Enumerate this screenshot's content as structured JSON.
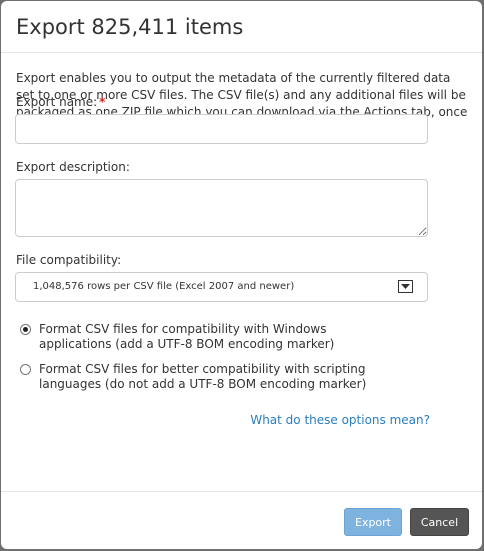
{
  "dialog": {
    "title": "Export 825,411 items",
    "intro": "Export enables you to output the metadata of the currently filtered data set to one or more CSV files. The CSV file(s) and any additional files will be packaged as one ZIP file which you can download via the Actions tab, once complete.",
    "export_name": {
      "label": "Export name:",
      "required_marker": "*",
      "value": ""
    },
    "export_description": {
      "label": "Export description:",
      "value": ""
    },
    "file_compatibility": {
      "label": "File compatibility:",
      "selected": "1,048,576 rows per CSV file (Excel 2007 and newer)"
    },
    "format_options": [
      {
        "label": "Format CSV files for compatibility with Windows applications (add a UTF-8 BOM encoding marker)",
        "checked": true
      },
      {
        "label": "Format CSV files for better compatibility with scripting languages (do not add a UTF-8 BOM encoding marker)",
        "checked": false
      }
    ],
    "help_link": "What do these options mean?",
    "buttons": {
      "export": "Export",
      "cancel": "Cancel"
    }
  },
  "colors": {
    "primary_button": "#7fb3df",
    "cancel_button": "#555555",
    "link": "#2a7ec1",
    "required": "#c9302c"
  }
}
